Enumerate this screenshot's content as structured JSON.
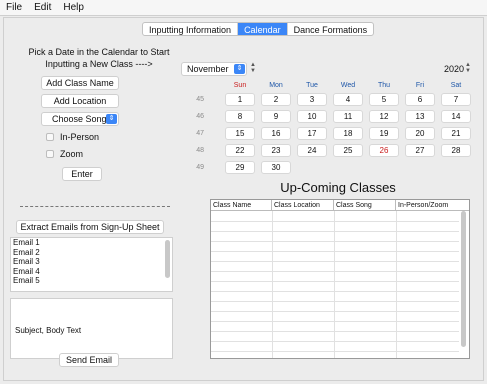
{
  "menu": [
    "File",
    "Edit",
    "Help"
  ],
  "tabs": [
    {
      "label": "Inputting Information",
      "active": false
    },
    {
      "label": "Calendar",
      "active": true
    },
    {
      "label": "Dance Formations",
      "active": false
    }
  ],
  "left": {
    "title_line1": "Pick a Date in the Calendar to Start",
    "title_line2": "Inputting a New Class ---->",
    "class_name_button": "Add Class Name",
    "location_button": "Add Location",
    "song_select": "Choose Song",
    "checkbox_in_person": "In-Person",
    "checkbox_zoom": "Zoom",
    "enter_button": "Enter",
    "extract_button": "Extract Emails from Sign-Up Sheet",
    "emails": [
      "Email 1",
      "Email 2",
      "Email 3",
      "Email 4",
      "Email 5"
    ],
    "message_text": "Subject, Body Text",
    "send_button": "Send Email"
  },
  "calendar": {
    "month": "November",
    "year": "2020",
    "weekdays": [
      "Sun",
      "Mon",
      "Tue",
      "Wed",
      "Thu",
      "Fri",
      "Sat"
    ],
    "weeks": [
      {
        "num": "45",
        "days": [
          "1",
          "2",
          "3",
          "4",
          "5",
          "6",
          "7"
        ]
      },
      {
        "num": "46",
        "days": [
          "8",
          "9",
          "10",
          "11",
          "12",
          "13",
          "14"
        ]
      },
      {
        "num": "47",
        "days": [
          "15",
          "16",
          "17",
          "18",
          "19",
          "20",
          "21"
        ]
      },
      {
        "num": "48",
        "days": [
          "22",
          "23",
          "24",
          "25",
          "26",
          "27",
          "28"
        ]
      },
      {
        "num": "49",
        "days": [
          "29",
          "30"
        ]
      }
    ],
    "highlight_day": "26",
    "highlight_color": "#c91c1c"
  },
  "classes": {
    "title": "Up-Coming Classes",
    "columns": [
      "Class Name",
      "Class Location",
      "Class Song",
      "In-Person/Zoom"
    ]
  },
  "colors": {
    "accent": "#3b86f7",
    "weekday": "#1f57a8",
    "sunday": "#c91c1c"
  }
}
